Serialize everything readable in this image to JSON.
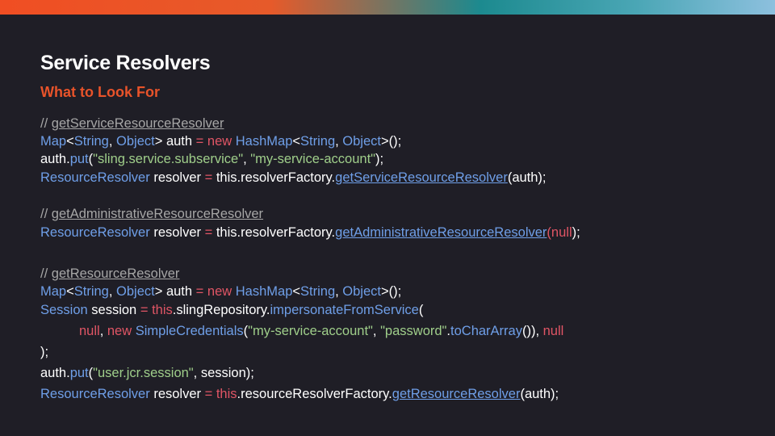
{
  "slide": {
    "title": "Service Resolvers",
    "subtitle": "What to Look For"
  },
  "code": {
    "b1": {
      "comment_prefix": "// ",
      "comment_link": "getServiceResourceResolver",
      "l2": {
        "t_map": "Map",
        "lt": "<",
        "t_string": "String",
        "comma": ", ",
        "t_object": "Object",
        "gt": ">",
        "var": " auth ",
        "eq": "=",
        "sp": " ",
        "kw_new": "new",
        "t_hashmap": " HashMap",
        "lt2": "<",
        "t_string2": "String",
        "comma2": ", ",
        "t_object2": "Object",
        "end": ">();"
      },
      "l3": {
        "obj": "auth.",
        "method": "put",
        "open": "(",
        "str1": "\"sling.service.subservice\"",
        "comma": ", ",
        "str2": "\"my-service-account\"",
        "close": ");"
      },
      "l4": {
        "type": "ResourceResolver",
        "var": " resolver ",
        "eq": "=",
        "rest": " this.resolverFactory.",
        "link": "getServiceResourceResolver",
        "end": "(auth);"
      }
    },
    "b2": {
      "comment_prefix": "// ",
      "comment_link": "getAdministrativeResourceResolver",
      "l2": {
        "type": "ResourceResolver",
        "var": " resolver ",
        "eq": "=",
        "rest": " this.resolverFactory.",
        "link": "getAdministrativeResourceResolver",
        "open": "(",
        "nullkw": "null",
        "end": ");"
      }
    },
    "b3": {
      "comment_prefix": "// ",
      "comment_link": "getResourceResolver",
      "l2": {
        "t_map": "Map",
        "lt": "<",
        "t_string": "String",
        "comma": ", ",
        "t_object": "Object",
        "gt": ">",
        "var": " auth ",
        "eq": "=",
        "sp": " ",
        "kw_new": "new",
        "t_hashmap": " HashMap",
        "lt2": "<",
        "t_string2": "String",
        "comma2": ", ",
        "t_object2": "Object",
        "end": ">();"
      },
      "l3": {
        "type": "Session",
        "var": " session ",
        "eq": "=",
        "sp": " ",
        "kw_this": "this",
        "rest": ".slingRepository.",
        "method": "impersonateFromService",
        "open": "("
      },
      "l4": {
        "nullkw": "null",
        "comma": ", ",
        "kw_new": "new",
        "sp": " ",
        "type": "SimpleCredentials",
        "open": "(",
        "str1": "\"my-service-account\"",
        "comma2": ", ",
        "str2": "\"password\"",
        "dot": ".",
        "method": "toCharArray",
        "close": "()), ",
        "nullkw2": "null"
      },
      "l5": {
        "text": ");"
      },
      "l6": {
        "obj": "auth.",
        "method": "put",
        "open": "(",
        "str1": "\"user.jcr.session\"",
        "end": ", session);"
      },
      "l7": {
        "type": "ResourceResolver",
        "var": " resolver ",
        "eq": "=",
        "sp": " ",
        "kw_this": "this",
        "rest": ".resourceResolverFactory.",
        "link": "getResourceResolver",
        "end": "(auth);"
      }
    }
  },
  "colors": {
    "background": "#1f1e26",
    "title": "#ffffff",
    "subtitle": "#e8532a",
    "type": "#6f9fe8",
    "keyword": "#e05565",
    "string": "#9fce8a",
    "comment": "#a6a6a6"
  }
}
